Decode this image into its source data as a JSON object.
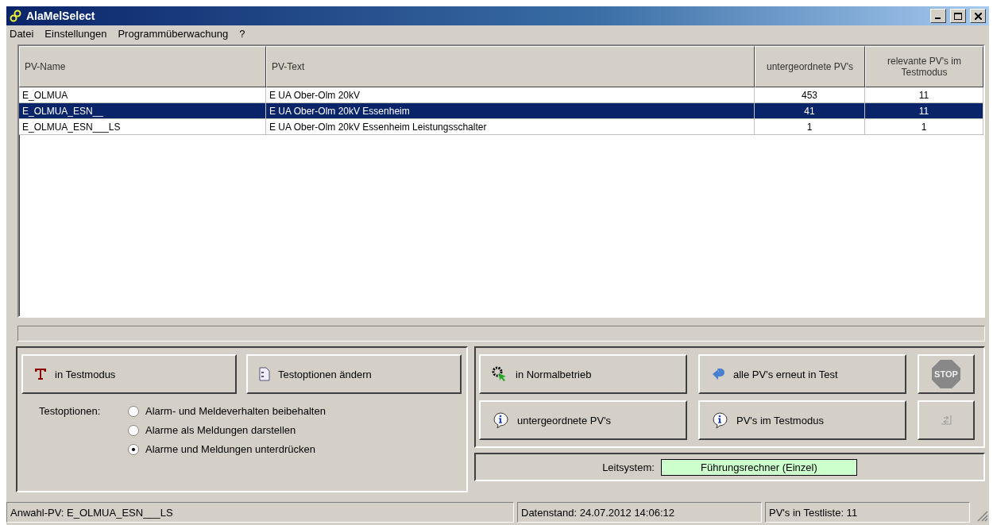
{
  "window": {
    "title": "AlaMelSelect"
  },
  "menu": [
    "Datei",
    "Einstellungen",
    "Programmüberwachung",
    "?"
  ],
  "table": {
    "columns": [
      "PV-Name",
      "PV-Text",
      "untergeordnete PV's",
      "relevante PV's im Testmodus"
    ],
    "rows": [
      {
        "cells": [
          "E_OLMUA",
          "E UA Ober-Olm 20kV",
          "453",
          "11"
        ],
        "selected": false
      },
      {
        "cells": [
          "E_OLMUA_ESN__",
          "E UA Ober-Olm 20kV Essenheim",
          "41",
          "11"
        ],
        "selected": true
      },
      {
        "cells": [
          "E_OLMUA_ESN___LS",
          "E UA Ober-Olm 20kV Essenheim Leistungsschalter",
          "1",
          "1"
        ],
        "selected": false
      }
    ]
  },
  "test_panel": {
    "buttons": [
      {
        "label": "in Testmodus",
        "kind": "test"
      },
      {
        "label": "Testoptionen ändern",
        "kind": "options"
      }
    ],
    "options_label": "Testoptionen:",
    "options": [
      {
        "label": "Alarm- und Meldeverhalten beibehalten",
        "selected": false
      },
      {
        "label": "Alarme als Meldungen darstellen",
        "selected": false
      },
      {
        "label": "Alarme und Meldungen unterdrücken",
        "selected": true
      }
    ]
  },
  "action_panel": {
    "buttons": [
      {
        "label": "in Normalbetrieb",
        "kind": "gear"
      },
      {
        "label": "alle PV's erneut in Test",
        "kind": "back"
      },
      {
        "label": "STOP",
        "kind": "stop"
      },
      {
        "label": "untergeordnete PV's",
        "kind": "info"
      },
      {
        "label": "PV's im Testmodus",
        "kind": "info"
      },
      {
        "kind": "swap",
        "disabled": true
      }
    ]
  },
  "leitsystem": {
    "label": "Leitsystem:",
    "value": "Führungsrechner (Einzel)"
  },
  "status_bar": [
    "Anwahl-PV: E_OLMUA_ESN___LS",
    "Datenstand: 24.07.2012 14:06:12",
    "PV's in Testliste: 11"
  ]
}
